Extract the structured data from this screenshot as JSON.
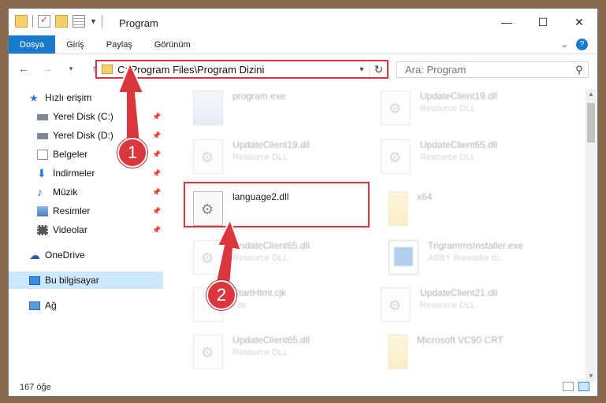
{
  "window": {
    "title": "Program",
    "controls": {
      "minimize": "—",
      "maximize": "☐",
      "close": "✕"
    }
  },
  "ribbon": {
    "tabs": [
      "Dosya",
      "Giriş",
      "Paylaş",
      "Görünüm"
    ],
    "active_tab": "Dosya",
    "expand_icon": "chevron-down-icon",
    "help": "?"
  },
  "address_bar": {
    "path": "C:\\Program Files\\Program Dizini"
  },
  "search": {
    "placeholder": "Ara: Program"
  },
  "sidebar": {
    "items": [
      {
        "label": "Hızlı erişim",
        "icon": "star-icon",
        "pinned": false
      },
      {
        "label": "Yerel Disk (C:)",
        "icon": "drive-icon",
        "pinned": true
      },
      {
        "label": "Yerel Disk (D:)",
        "icon": "drive-icon",
        "pinned": true
      },
      {
        "label": "Belgeler",
        "icon": "documents-icon",
        "pinned": true
      },
      {
        "label": "İndirmeler",
        "icon": "download-icon",
        "pinned": true
      },
      {
        "label": "Müzik",
        "icon": "music-icon",
        "pinned": true
      },
      {
        "label": "Resimler",
        "icon": "pictures-icon",
        "pinned": true
      },
      {
        "label": "Videolar",
        "icon": "video-icon",
        "pinned": true
      },
      {
        "label": "OneDrive",
        "icon": "cloud-icon",
        "pinned": false
      },
      {
        "label": "Bu bilgisayar",
        "icon": "computer-icon",
        "pinned": false,
        "selected": true
      },
      {
        "label": "Ağ",
        "icon": "network-icon",
        "pinned": false
      }
    ]
  },
  "files": [
    {
      "name": "program.exe",
      "type": "",
      "icon": "exe"
    },
    {
      "name": "UpdateClient19.dll",
      "type": "Resource DLL",
      "icon": "dll"
    },
    {
      "name": "UpdateClient19.dll",
      "type": "Resource DLL",
      "icon": "dll"
    },
    {
      "name": "UpdateClient65.dll",
      "type": "Resource DLL",
      "icon": "dll"
    },
    {
      "name": "language2.dll",
      "type": "",
      "icon": "dll",
      "highlighted": true
    },
    {
      "name": "x64",
      "type": "",
      "icon": "folder"
    },
    {
      "name": "UpdateClient65.dll",
      "type": "Resource DLL",
      "icon": "dll"
    },
    {
      "name": "TrigrammsInstaller.exe",
      "type": "ABBY fineeader tri..",
      "icon": "winapp"
    },
    {
      "name": "StartHtml.cjk",
      "type": "File",
      "icon": "doc"
    },
    {
      "name": "UpdateClient21.dll",
      "type": "Resource DLL",
      "icon": "dll"
    },
    {
      "name": "UpdateClient65.dll",
      "type": "Resource DLL",
      "icon": "dll"
    },
    {
      "name": "Microsoft VC90 CRT",
      "type": "",
      "icon": "folder"
    }
  ],
  "status": {
    "count": "167 öğe"
  },
  "annotations": {
    "step1": "1",
    "step2": "2",
    "color": "#d9363e"
  }
}
